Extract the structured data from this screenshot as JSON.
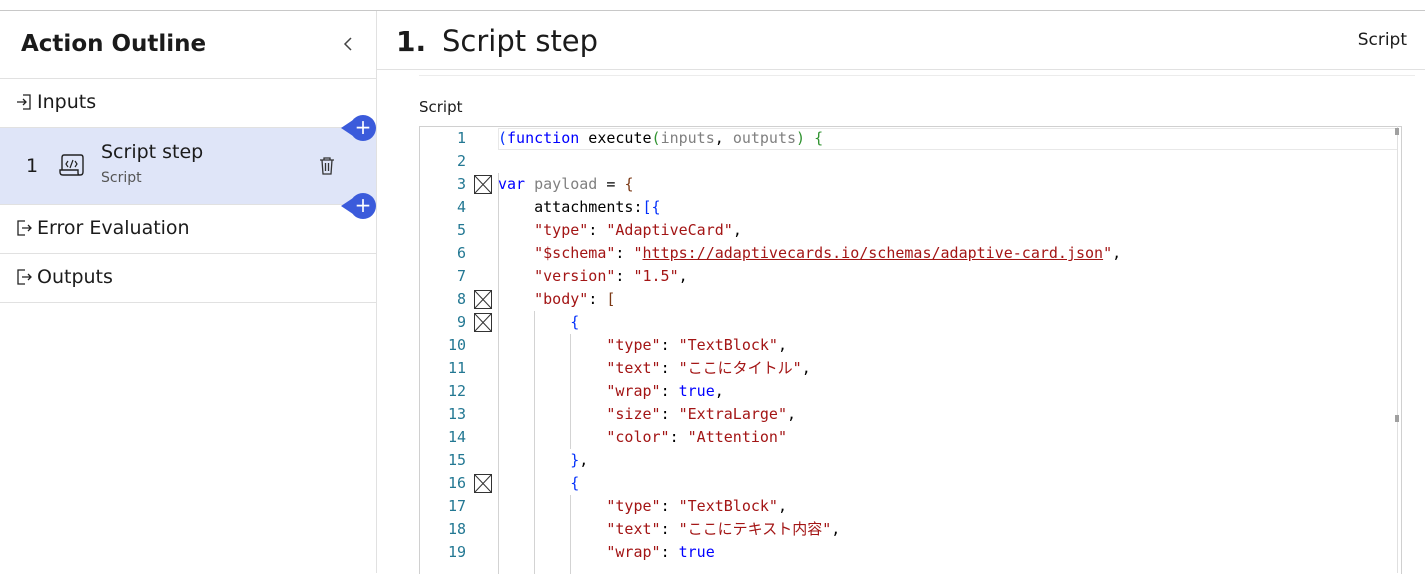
{
  "sidebar": {
    "title": "Action Outline",
    "inputs_label": "Inputs",
    "step": {
      "number": "1",
      "title": "Script step",
      "subtitle": "Script"
    },
    "error_label": "Error Evaluation",
    "outputs_label": "Outputs",
    "add_symbol": "+"
  },
  "main": {
    "step_number": "1.",
    "step_title": "Script step",
    "step_type": "Script",
    "script_label": "Script"
  },
  "editor": {
    "line_numbers": [
      "1",
      "2",
      "3",
      "4",
      "5",
      "6",
      "7",
      "8",
      "9",
      "10",
      "11",
      "12",
      "13",
      "14",
      "15",
      "16",
      "17",
      "18",
      "19"
    ],
    "lines": [
      "(function execute(inputs, outputs) {",
      "",
      "var payload = {",
      "    attachments:[{",
      "    \"type\": \"AdaptiveCard\",",
      "    \"$schema\": \"https://adaptivecards.io/schemas/adaptive-card.json\",",
      "    \"version\": \"1.5\",",
      "    \"body\": [",
      "        {",
      "            \"type\": \"TextBlock\",",
      "            \"text\": \"ここにタイトル\",",
      "            \"wrap\": true,",
      "            \"size\": \"ExtraLarge\",",
      "            \"color\": \"Attention\"",
      "        },",
      "        {",
      "            \"type\": \"TextBlock\",",
      "            \"text\": \"ここにテキスト内容\",",
      "            \"wrap\": true"
    ]
  },
  "colors": {
    "accent": "#3b5bdb",
    "selected_bg": "#dfe5f8",
    "line_number": "#237893",
    "keyword": "#0000ff",
    "string": "#a31515"
  }
}
